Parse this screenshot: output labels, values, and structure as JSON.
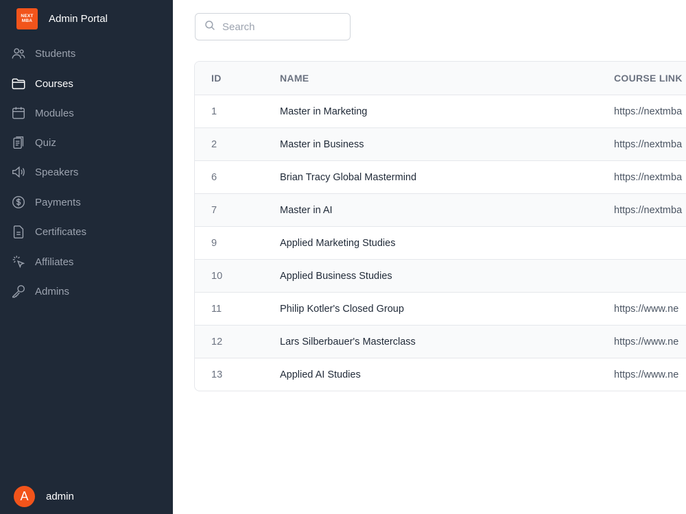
{
  "brand": {
    "logo_line1": "NEXT",
    "logo_line2": "MBA",
    "title": "Admin Portal"
  },
  "sidebar": {
    "items": [
      {
        "label": "Students",
        "icon": "users-icon"
      },
      {
        "label": "Courses",
        "icon": "folder-icon",
        "active": true
      },
      {
        "label": "Modules",
        "icon": "calendar-icon"
      },
      {
        "label": "Quiz",
        "icon": "clipboard-icon"
      },
      {
        "label": "Speakers",
        "icon": "speaker-icon"
      },
      {
        "label": "Payments",
        "icon": "dollar-icon"
      },
      {
        "label": "Certificates",
        "icon": "document-icon"
      },
      {
        "label": "Affiliates",
        "icon": "cursor-click-icon"
      },
      {
        "label": "Admins",
        "icon": "key-icon"
      }
    ]
  },
  "user": {
    "avatar_letter": "A",
    "name": "admin"
  },
  "search": {
    "placeholder": "Search",
    "value": ""
  },
  "table": {
    "headers": {
      "id": "ID",
      "name": "NAME",
      "link": "COURSE LINK"
    },
    "rows": [
      {
        "id": "1",
        "name": "Master in Marketing",
        "link": "https://nextmba"
      },
      {
        "id": "2",
        "name": "Master in Business",
        "link": "https://nextmba"
      },
      {
        "id": "6",
        "name": "Brian Tracy Global Mastermind",
        "link": "https://nextmba"
      },
      {
        "id": "7",
        "name": "Master in AI",
        "link": "https://nextmba"
      },
      {
        "id": "9",
        "name": "Applied Marketing Studies",
        "link": ""
      },
      {
        "id": "10",
        "name": "Applied Business Studies",
        "link": ""
      },
      {
        "id": "11",
        "name": "Philip Kotler's Closed Group",
        "link": "https://www.ne"
      },
      {
        "id": "12",
        "name": "Lars Silberbauer's Masterclass",
        "link": "https://www.ne"
      },
      {
        "id": "13",
        "name": "Applied AI Studies",
        "link": "https://www.ne"
      }
    ]
  },
  "colors": {
    "sidebar_bg": "#1f2937",
    "accent": "#f2541b"
  }
}
